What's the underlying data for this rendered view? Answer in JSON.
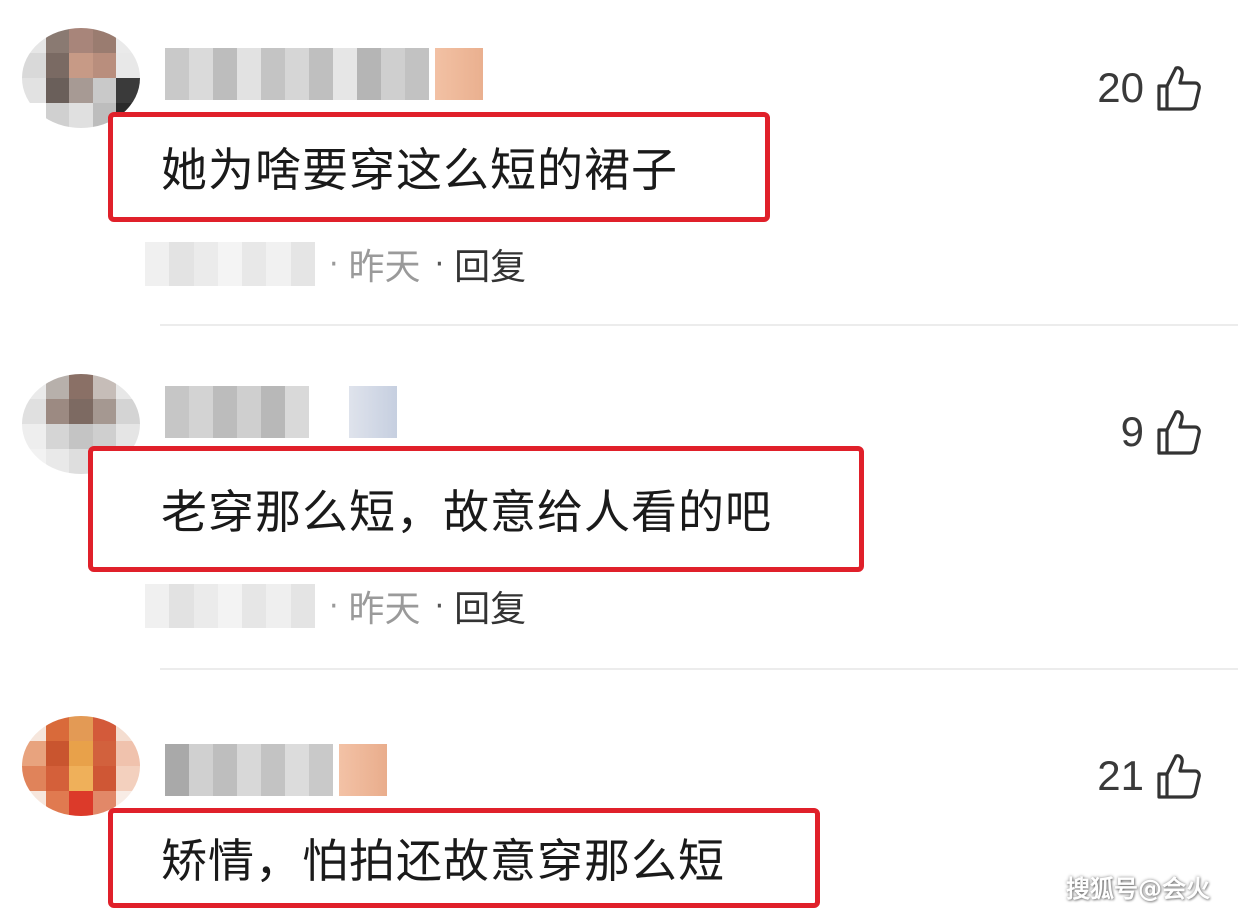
{
  "comments": [
    {
      "text": "她为啥要穿这么短的裙子",
      "time": "昨天",
      "reply": "回复",
      "likes": "20",
      "dot": "·"
    },
    {
      "text": "老穿那么短，故意给人看的吧",
      "time": "昨天",
      "reply": "回复",
      "likes": "9",
      "dot": "·"
    },
    {
      "text": "矫情，怕拍还故意穿那么短",
      "time": "",
      "reply": "",
      "likes": "21",
      "dot": ""
    }
  ],
  "watermark": "搜狐号@会火",
  "colors": {
    "highlight_border": "#e0202a",
    "meta_text": "#9a9a9a",
    "like_text": "#3a3a3a"
  },
  "icons": {
    "like": "thumbs-up-icon"
  }
}
